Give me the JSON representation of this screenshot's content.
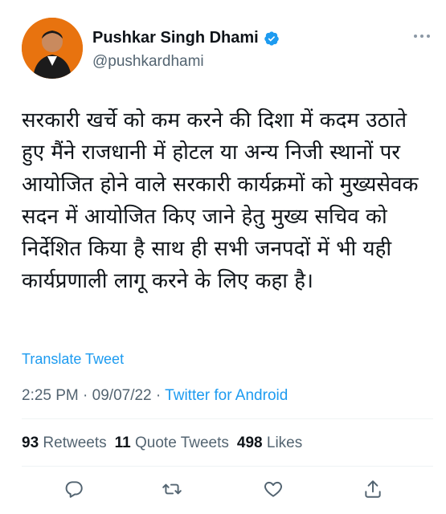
{
  "author": {
    "name": "Pushkar Singh Dhami",
    "handle": "@pushkardhami",
    "verified": true
  },
  "tweet": {
    "text": "सरकारी खर्चे को कम करने की दिशा में कदम उठाते हुए मैंने राजधानी में होटल या अन्य निजी स्थानों पर आयोजित होने वाले सरकारी कार्यक्रमों को मुख्यसेवक सदन में आयोजित किए जाने हेतु मुख्य सचिव को निर्देशित किया है साथ ही सभी जनपदों में भी यही कार्यप्रणाली लागू करने के लिए कहा है।",
    "translate_label": "Translate Tweet",
    "time": "2:25 PM",
    "date": "09/07/22",
    "separator": "·",
    "source": "Twitter for Android"
  },
  "stats": {
    "retweets_count": "93",
    "retweets_label": "Retweets",
    "quotes_count": "11",
    "quotes_label": "Quote Tweets",
    "likes_count": "498",
    "likes_label": "Likes"
  },
  "colors": {
    "accent": "#1d9bf0",
    "secondary_text": "#536471",
    "primary_text": "#0f1419",
    "avatar_bg": "#e8730f"
  },
  "icons": [
    "verified-icon",
    "more-icon",
    "reply-icon",
    "retweet-icon",
    "like-icon",
    "share-icon"
  ]
}
